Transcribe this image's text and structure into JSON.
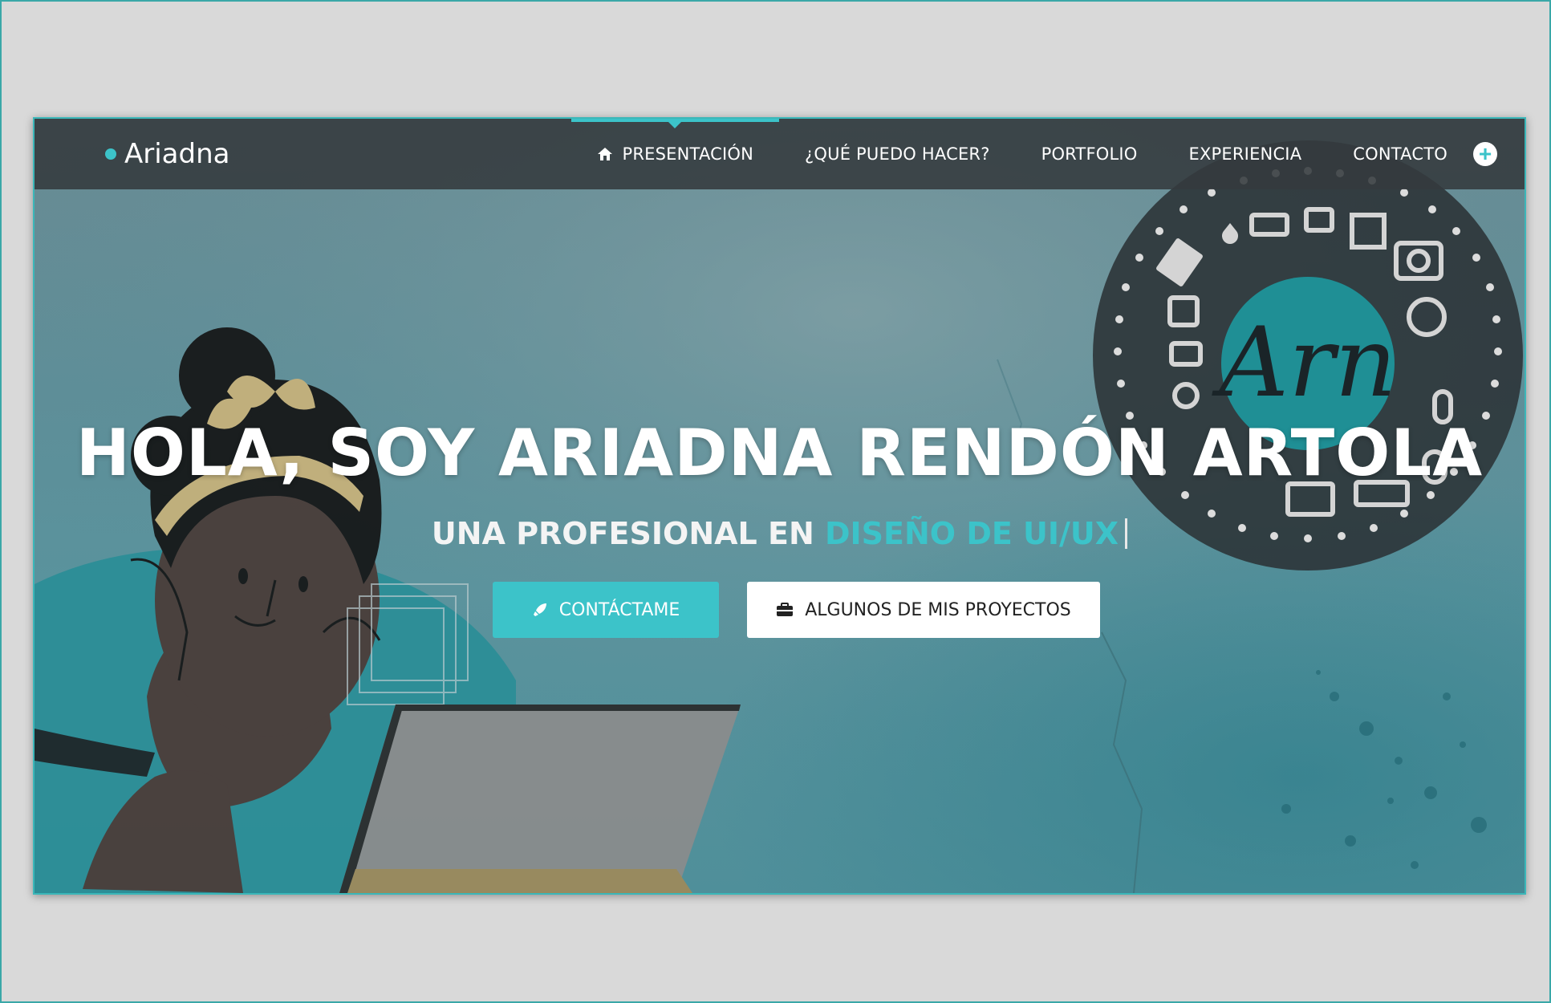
{
  "brand": {
    "name": "Ariadna",
    "accent": "#3cc3c9"
  },
  "nav": {
    "items": [
      {
        "label": "PRESENTACIÓN",
        "icon": "home-icon",
        "active": true
      },
      {
        "label": "¿QUÉ PUEDO HACER?",
        "active": false
      },
      {
        "label": "PORTFOLIO",
        "active": false
      },
      {
        "label": "EXPERIENCIA",
        "active": false
      },
      {
        "label": "CONTACTO",
        "active": false
      }
    ],
    "extra_icon": "plus-circle-icon"
  },
  "hero": {
    "title": "HOLA, SOY ARIADNA RENDÓN ARTOLA",
    "subtitle_prefix": "UNA PROFESIONAL EN ",
    "subtitle_highlight": "DISEÑO DE UI/UX"
  },
  "buttons": {
    "primary": {
      "label": "CONTÁCTAME",
      "icon": "rocket-icon"
    },
    "secondary": {
      "label": "ALGUNOS DE MIS PROYECTOS",
      "icon": "briefcase-icon"
    }
  },
  "logo": {
    "monogram": "Arn"
  },
  "colors": {
    "navbar": "#343a3e",
    "accent": "#3cc3c9",
    "skin": "#4a3a36",
    "shirt": "#2b8e97",
    "headband": "#c9b27a"
  }
}
